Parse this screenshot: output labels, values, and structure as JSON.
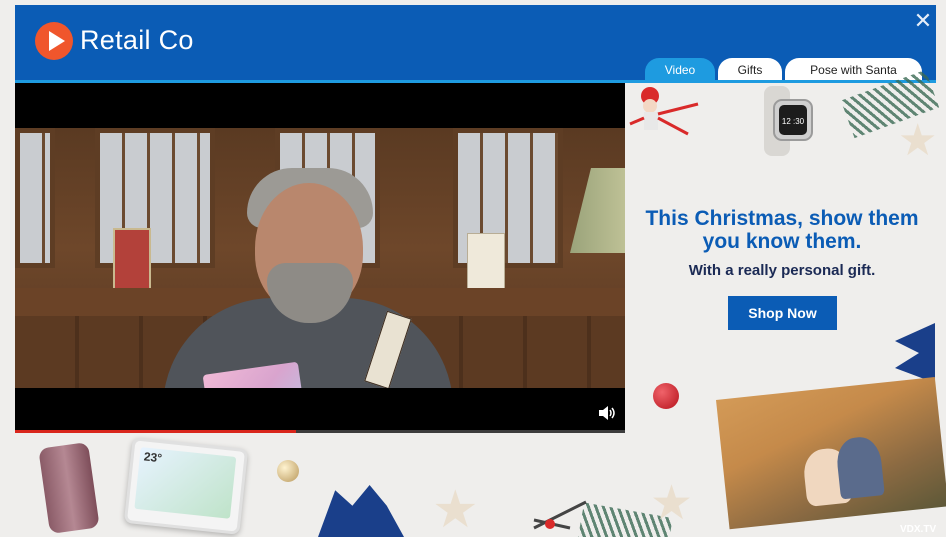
{
  "brand": {
    "name": "Retail Co",
    "color": "#0b5cb5",
    "logo_color": "#f0562c"
  },
  "header": {
    "close_icon": "close-icon"
  },
  "tabs": [
    {
      "label": "Video",
      "active": true
    },
    {
      "label": "Gifts",
      "active": false
    },
    {
      "label": "Pose with Santa",
      "active": false
    }
  ],
  "video": {
    "progress": 0.46,
    "volume_icon": "speaker-icon"
  },
  "promo": {
    "headline": "This Christmas, show them you know them.",
    "subline": "With a really personal gift.",
    "cta_label": "Shop Now"
  },
  "products": {
    "watch_time": "12 :30",
    "hub_temp": "23°"
  },
  "watermark": "VDX.TV"
}
